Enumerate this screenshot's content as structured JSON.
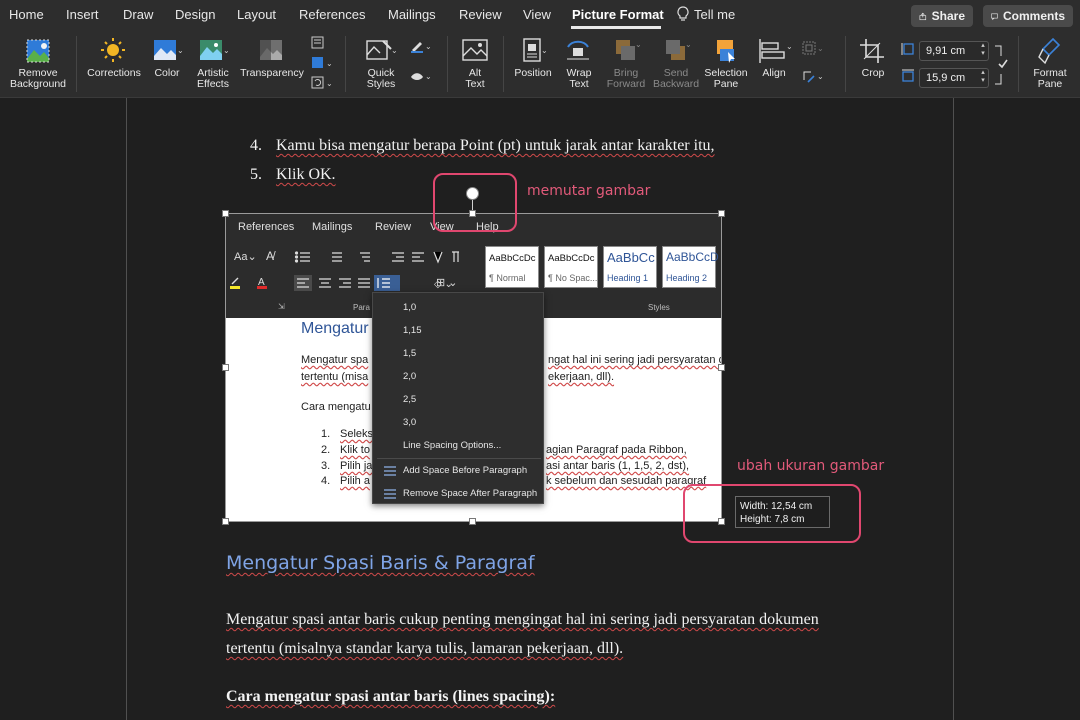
{
  "tabs": [
    {
      "label": "Home",
      "active": false
    },
    {
      "label": "Insert",
      "active": false
    },
    {
      "label": "Draw",
      "active": false
    },
    {
      "label": "Design",
      "active": false
    },
    {
      "label": "Layout",
      "active": false
    },
    {
      "label": "References",
      "active": false
    },
    {
      "label": "Mailings",
      "active": false
    },
    {
      "label": "Review",
      "active": false
    },
    {
      "label": "View",
      "active": false
    },
    {
      "label": "Picture Format",
      "active": true
    }
  ],
  "tell_me": "Tell me",
  "share_label": "Share",
  "comments_label": "Comments",
  "ribbon": {
    "remove_background": [
      "Remove",
      "Background"
    ],
    "corrections": "Corrections",
    "color": "Color",
    "artistic_effects": [
      "Artistic",
      "Effects"
    ],
    "transparency": "Transparency",
    "quick_styles": [
      "Quick",
      "Styles"
    ],
    "alt_text": [
      "Alt",
      "Text"
    ],
    "position": "Position",
    "wrap_text": [
      "Wrap",
      "Text"
    ],
    "bring_forward": [
      "Bring",
      "Forward"
    ],
    "send_backward": [
      "Send",
      "Backward"
    ],
    "selection_pane": [
      "Selection",
      "Pane"
    ],
    "align": "Align",
    "crop": "Crop",
    "height_value": "9,91 cm",
    "width_value": "15,9 cm",
    "format_pane": [
      "Format",
      "Pane"
    ]
  },
  "document": {
    "step4_num": "4.",
    "step4_text": "Kamu bisa mengatur berapa Point (pt) untuk jarak antar karakter itu,",
    "step5_num": "5.",
    "step5_text": "Klik OK.",
    "heading": "Mengatur Spasi Baris & Paragraf",
    "para_line1": "Mengatur spasi antar baris cukup penting mengingat hal ini sering jadi persyaratan dokumen",
    "para_line2": "tertentu (misalnya standar karya tulis, lamaran pekerjaan, dll).",
    "subheading": "Cara mengatur spasi antar baris (lines spacing):"
  },
  "picture": {
    "tabs": [
      "References",
      "Mailings",
      "Review",
      "View",
      "Help"
    ],
    "styles": [
      {
        "sample": "AaBbCcDc",
        "name": "¶ Normal"
      },
      {
        "sample": "AaBbCcDc",
        "name": "¶ No Spac..."
      },
      {
        "sample": "AaBbCc",
        "name": "Heading 1"
      },
      {
        "sample": "AaBbCcD",
        "name": "Heading 2"
      }
    ],
    "group_para": "Para",
    "group_styles": "Styles",
    "doc_heading": "Mengatur",
    "doc_line1a": "Mengatur spa",
    "doc_line1b": "ngat hal ini sering jadi persyaratan d",
    "doc_line2a": "tertentu (misa",
    "doc_line2b": "ekerjaan, dll).",
    "doc_line3": "Cara mengatu",
    "list": [
      {
        "num": "1.",
        "a": "Seleks",
        "b": ""
      },
      {
        "num": "2.",
        "a": "Klik to",
        "b": "agian Paragraf pada Ribbon,"
      },
      {
        "num": "3.",
        "a": "Pilih ja",
        "b": "asi antar baris (1, 1,5, 2, dst),"
      },
      {
        "num": "4.",
        "a": "Pilih a",
        "b": "k sebelum dan sesudah paragraf"
      }
    ],
    "line_spacing_menu": {
      "values": [
        "1,0",
        "1,15",
        "1,5",
        "2,0",
        "2,5",
        "3,0"
      ],
      "options": "Line Spacing Options...",
      "add_before": "Add Space Before Paragraph",
      "remove_after": "Remove Space After Paragraph"
    }
  },
  "annotations": {
    "rotate": "memutar gambar",
    "resize": "ubah ukuran gambar",
    "accent_color": "#e0476f"
  },
  "size_tooltip": {
    "width": "Width: 12,54 cm",
    "height": "Height: 7,8 cm"
  }
}
